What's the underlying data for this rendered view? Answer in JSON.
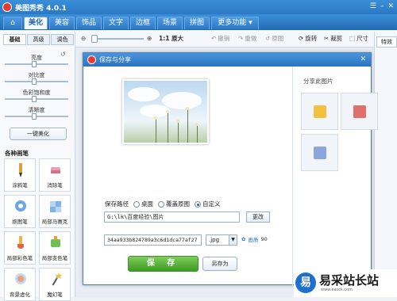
{
  "app": {
    "title": "美图秀秀 4.0.1"
  },
  "main_tabs": [
    {
      "label": "美化",
      "active": true
    },
    {
      "label": "美容"
    },
    {
      "label": "饰品"
    },
    {
      "label": "文字"
    },
    {
      "label": "边框"
    },
    {
      "label": "场景"
    },
    {
      "label": "拼图"
    },
    {
      "label": "更多功能 ▾"
    }
  ],
  "toolbar": {
    "ratio_label": "1:1 原大",
    "undo": "撤销",
    "redo": "重做",
    "restore": "原图",
    "rotate": "旋转",
    "crop": "裁剪",
    "size": "尺寸"
  },
  "left_panel": {
    "subtabs": [
      "基础",
      "高级",
      "调色"
    ],
    "adjustments": [
      "亮度",
      "对比度",
      "色彩饱和度",
      "清晰度"
    ],
    "one_click": "一键美化",
    "section_title": "各种画笔",
    "pens": [
      "涂鸦笔",
      "消除笔",
      "抠图笔",
      "局部马赛克",
      "局部彩色笔",
      "局部变色笔",
      "背景虚化",
      "魔幻笔"
    ]
  },
  "right_strip": {
    "tab": "特效"
  },
  "dialog": {
    "title": "保存与分享",
    "close": "✕",
    "save_path_label": "保存路径",
    "radio_options": [
      {
        "label": "桌面",
        "checked": false
      },
      {
        "label": "覆盖原图",
        "checked": false
      },
      {
        "label": "自定义",
        "checked": true
      }
    ],
    "path_value": "G:\\lk\\百度经验\\图片",
    "change_button": "更改",
    "filename_value": "34aa933b824789a3c6d1dca77af27",
    "format": ".jpg",
    "quality_label": "画质",
    "quality_value": "90",
    "save_button": "保 存",
    "save_as_button": "另存为",
    "share_title": "分享此图片",
    "share_colors": [
      "#f4c040",
      "#e0706a",
      "#8aa6da"
    ]
  },
  "watermark": {
    "logo": "易",
    "text": "易采站长站",
    "url": "www.easck.com"
  }
}
